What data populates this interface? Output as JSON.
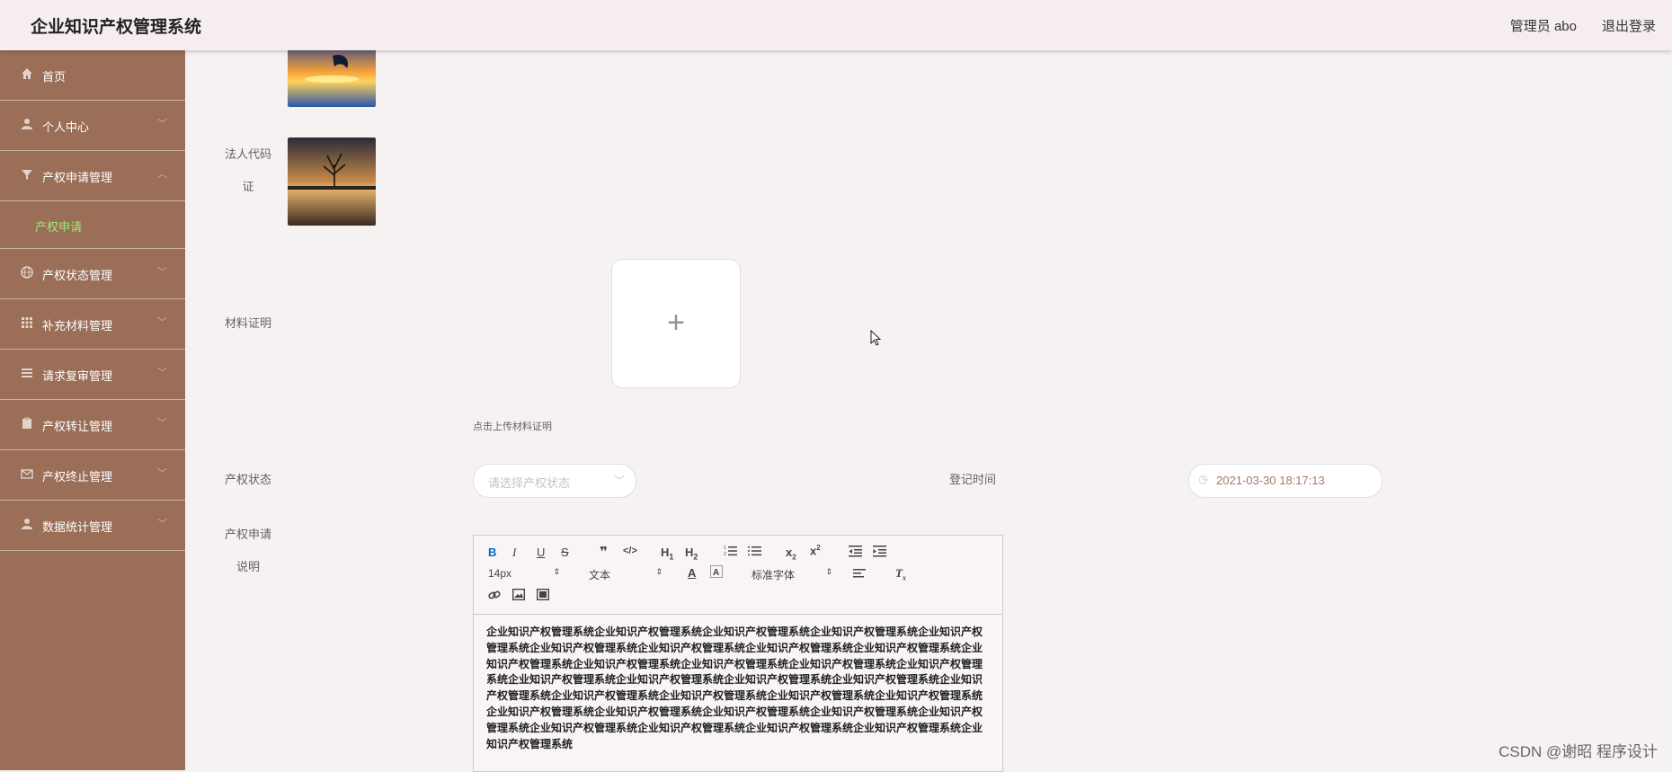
{
  "header": {
    "title": "企业知识产权管理系统",
    "user": "管理员 abo",
    "logout": "退出登录"
  },
  "sidebar": {
    "items": [
      {
        "label": "首页",
        "icon": "home-icon"
      },
      {
        "label": "个人中心",
        "icon": "user-icon"
      },
      {
        "label": "产权申请管理",
        "icon": "funnel-icon",
        "expanded": true
      },
      {
        "label": "产权状态管理",
        "icon": "globe-icon"
      },
      {
        "label": "补充材料管理",
        "icon": "grid-icon"
      },
      {
        "label": "请求复审管理",
        "icon": "list-icon"
      },
      {
        "label": "产权转让管理",
        "icon": "clipboard-icon"
      },
      {
        "label": "产权终止管理",
        "icon": "mail-icon"
      },
      {
        "label": "数据统计管理",
        "icon": "user-icon"
      }
    ],
    "sub_item": "产权申请"
  },
  "form": {
    "legal_code_label_line1": "法人代码",
    "legal_code_label_line2": "证",
    "material_label": "材料证明",
    "upload_tip": "点击上传材料证明",
    "status_label": "产权状态",
    "status_placeholder": "请选择产权状态",
    "time_label": "登记时间",
    "time_value": "2021-03-30 18:17:13",
    "desc_label_line1": "产权申请",
    "desc_label_line2": "说明"
  },
  "editor": {
    "font_size": "14px",
    "text_style": "文本",
    "font_family": "标准字体",
    "content": "企业知识产权管理系统企业知识产权管理系统企业知识产权管理系统企业知识产权管理系统企业知识产权管理系统企业知识产权管理系统企业知识产权管理系统企业知识产权管理系统企业知识产权管理系统企业知识产权管理系统企业知识产权管理系统企业知识产权管理系统企业知识产权管理系统企业知识产权管理系统企业知识产权管理系统企业知识产权管理系统企业知识产权管理系统企业知识产权管理系统企业知识产权管理系统企业知识产权管理系统企业知识产权管理系统企业知识产权管理系统企业知识产权管理系统企业知识产权管理系统企业知识产权管理系统企业知识产权管理系统企业知识产权管理系统企业知识产权管理系统企业知识产权管理系统企业知识产权管理系统企业知识产权管理系统企业知识产权管理系统企业知识产权管理系统"
  },
  "watermark": "CSDN @谢昭  程序设计"
}
